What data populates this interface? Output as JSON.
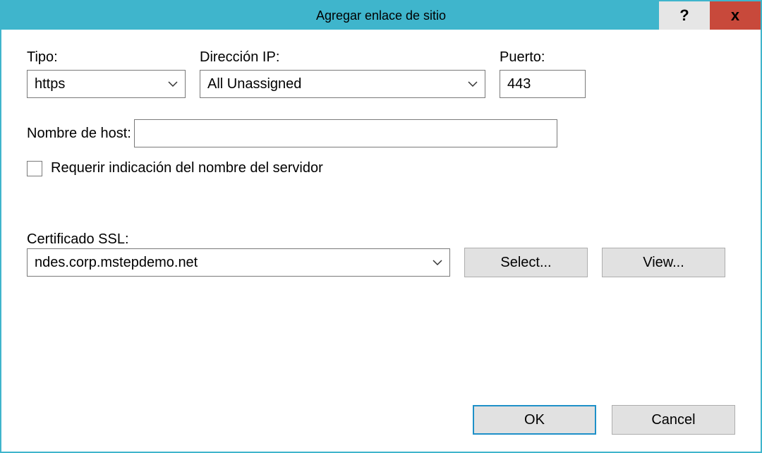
{
  "title": "Agregar enlace de sitio",
  "labels": {
    "type": "Tipo:",
    "ip": "Dirección IP:",
    "port": "Puerto:",
    "hostname": "Nombre de host:",
    "sni": "Requerir indicación del nombre del servidor",
    "ssl": "Certificado SSL:"
  },
  "values": {
    "type": "https",
    "ip": "All Unassigned",
    "port": "443",
    "hostname": "",
    "sni_checked": false,
    "ssl": "ndes.corp.mstepdemo.net"
  },
  "buttons": {
    "select": "Select...",
    "view": "View...",
    "ok": "OK",
    "cancel": "Cancel",
    "help": "?",
    "close": "x"
  }
}
